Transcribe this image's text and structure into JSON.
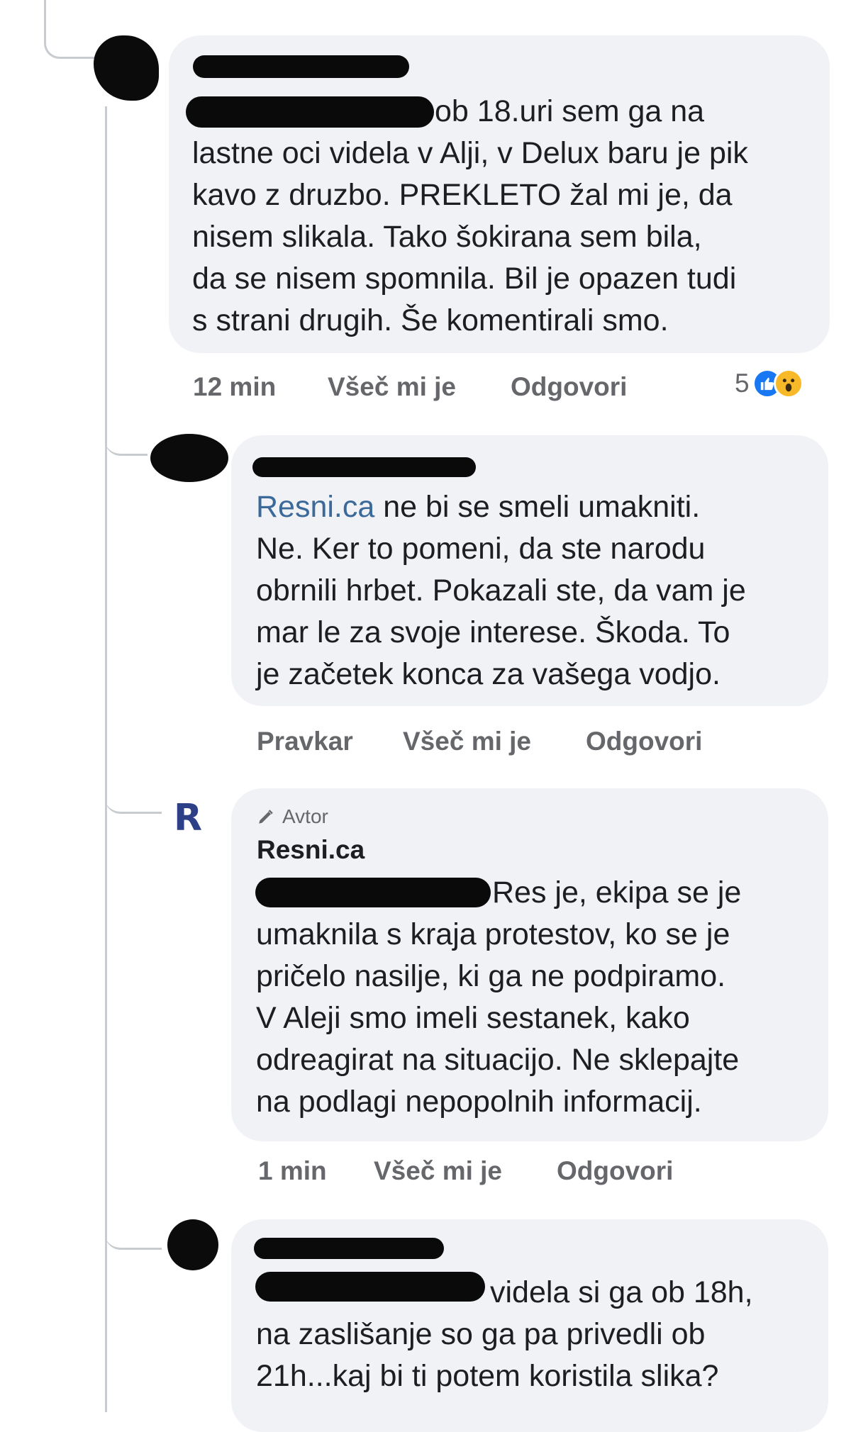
{
  "colors": {
    "bubble_bg": "#f0f2f5",
    "action_text": "#65676b",
    "mention_link": "#3b6a9a",
    "like_blue": "#1877f2",
    "wow_yellow": "#f7b928",
    "page_logo": "#2d3f86"
  },
  "comments": [
    {
      "id": "comment-1",
      "text": "ob 18.uri sem ga na\nlastne oci videla v Alji, v Delux baru je pik\nkavo z druzbo. PREKLETO žal mi je, da\nnisem slikala. Tako šokirana sem bila,\nda se nisem spomnila. Bil je opazen tudi\ns strani drugih. Še komentirali smo.",
      "time": "12 min",
      "like_label": "Všeč mi je",
      "reply_label": "Odgovori",
      "reaction_count": "5",
      "reaction_icons": [
        "like-icon",
        "wow-icon"
      ]
    },
    {
      "id": "comment-2",
      "mention": "Resni.ca",
      "text_after_mention": " ne bi se smeli umakniti.\nNe. Ker to pomeni, da ste narodu\nobrnili hrbet. Pokazali ste, da vam je\nmar le za svoje interese. Škoda. To\nje začetek konca za vašega vodjo.",
      "time": "Pravkar",
      "like_label": "Všeč mi je",
      "reply_label": "Odgovori"
    },
    {
      "id": "comment-3",
      "author_badge": "Avtor",
      "author_name": "Resni.ca",
      "avatar_logo": "R",
      "text": "Res je, ekipa se je\numaknila s kraja protestov, ko se je\npričelo nasilje, ki ga ne podpiramo.\nV Aleji smo imeli sestanek, kako\nodreagirat na situacijo. Ne sklepajte\nna podlagi nepopolnih informacij.",
      "time": "1 min",
      "like_label": "Všeč mi je",
      "reply_label": "Odgovori"
    },
    {
      "id": "comment-4",
      "text": "videla si ga ob 18h,\nna zaslišanje so ga pa privedli ob\n21h...kaj bi ti potem koristila slika?"
    }
  ]
}
